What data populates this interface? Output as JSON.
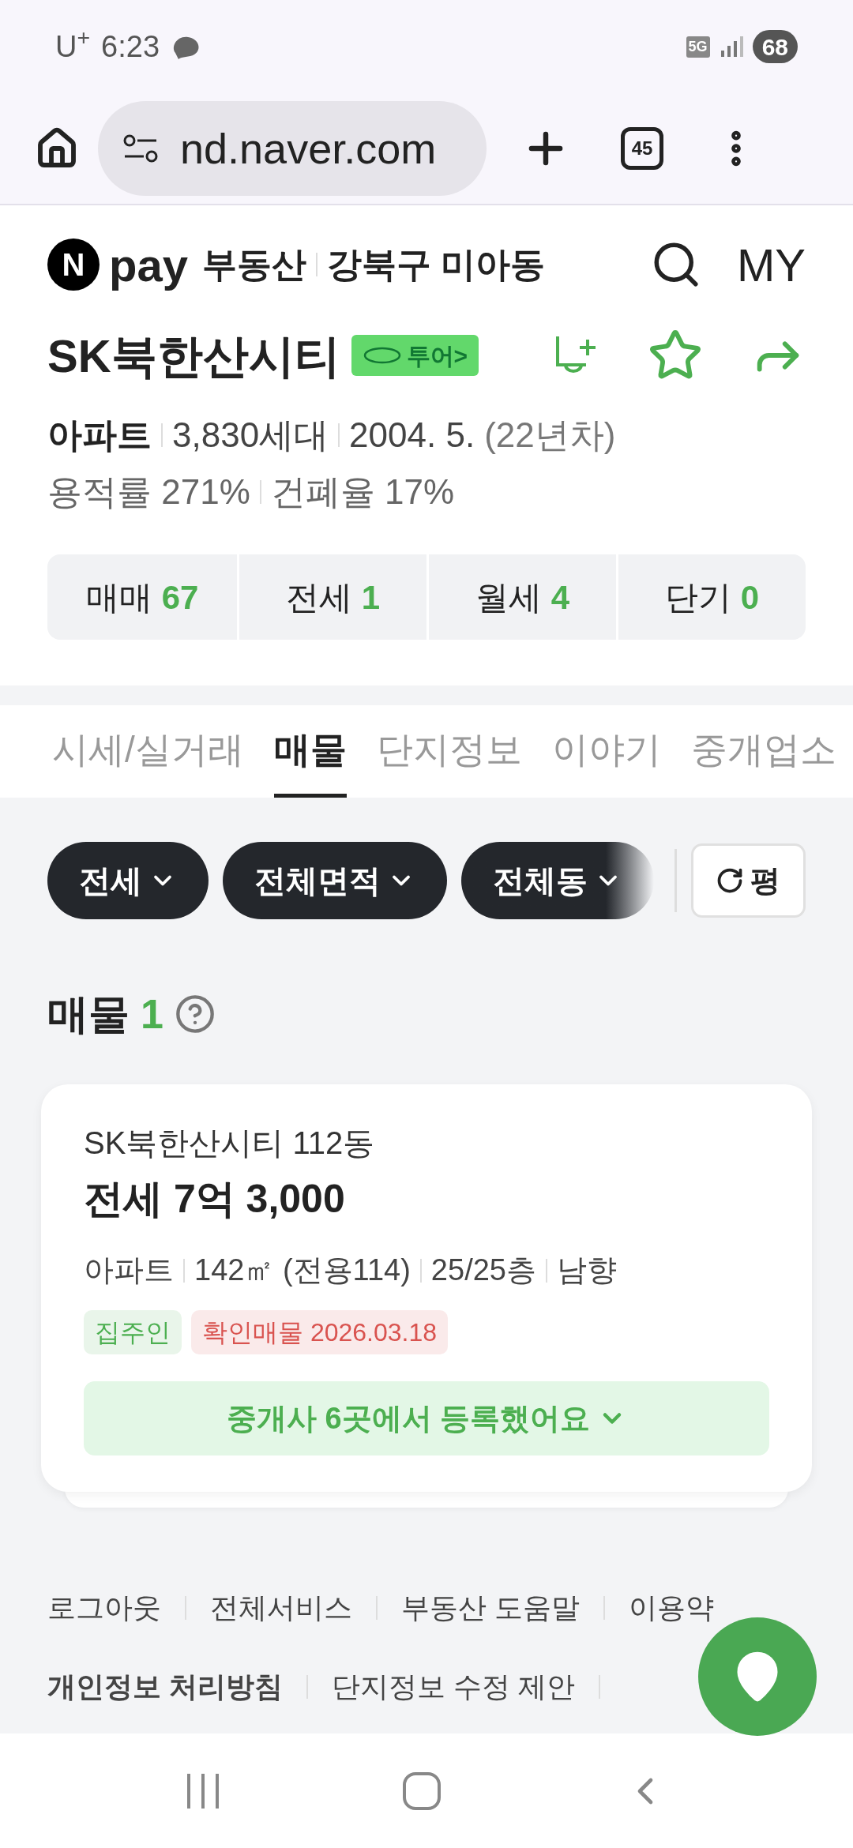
{
  "status_bar": {
    "carrier": "U$^{+}$",
    "time": "6:23",
    "network": "5G",
    "battery": "68"
  },
  "browser": {
    "url": "nd.naver.com",
    "tab_count": "45"
  },
  "header": {
    "logo_letter": "N",
    "brand": "pay",
    "service": "부동산",
    "location": "강북구 미아동",
    "my": "MY"
  },
  "complex": {
    "name": "SK북한산시티",
    "vr_badge": "투어>",
    "type": "아파트",
    "households": "3,830세대",
    "built": "2004. 5.",
    "age": "(22년차)",
    "floor_area_ratio": "용적률 271%",
    "coverage_ratio": "건폐율 17%"
  },
  "deal_counts": [
    {
      "label": "매매",
      "count": "67"
    },
    {
      "label": "전세",
      "count": "1"
    },
    {
      "label": "월세",
      "count": "4"
    },
    {
      "label": "단기",
      "count": "0"
    }
  ],
  "tabs": [
    {
      "label": "시세/실거래",
      "selected": false
    },
    {
      "label": "매물",
      "selected": true
    },
    {
      "label": "단지정보",
      "selected": false
    },
    {
      "label": "이야기",
      "selected": false
    },
    {
      "label": "중개업소",
      "selected": false
    }
  ],
  "filters": [
    {
      "label": "전세"
    },
    {
      "label": "전체면적"
    },
    {
      "label": "전체동"
    }
  ],
  "unit_button": "평",
  "listings_heading": {
    "title": "매물",
    "count": "1"
  },
  "listings": [
    {
      "building": "SK북한산시티 112동",
      "price": "전세 7억 3,000",
      "details": [
        "아파트",
        "142㎡ (전용114)",
        "25/25층",
        "남향"
      ],
      "tags": [
        {
          "label": "집주인",
          "color": "#4caf50"
        },
        {
          "label": "확인매물 2026.03.18",
          "color": "#d9534f"
        }
      ],
      "agents_button": "중개사 6곳에서 등록했어요"
    }
  ],
  "footer_links": [
    [
      {
        "label": "로그아웃",
        "bold": false
      },
      {
        "label": "전체서비스",
        "bold": false
      },
      {
        "label": "부동산 도움말",
        "bold": false
      },
      {
        "label": "이용약",
        "bold": false
      }
    ],
    [
      {
        "label": "개인정보 처리방침",
        "bold": true
      },
      {
        "label": "단지정보 수정 제안",
        "bold": false
      }
    ]
  ]
}
